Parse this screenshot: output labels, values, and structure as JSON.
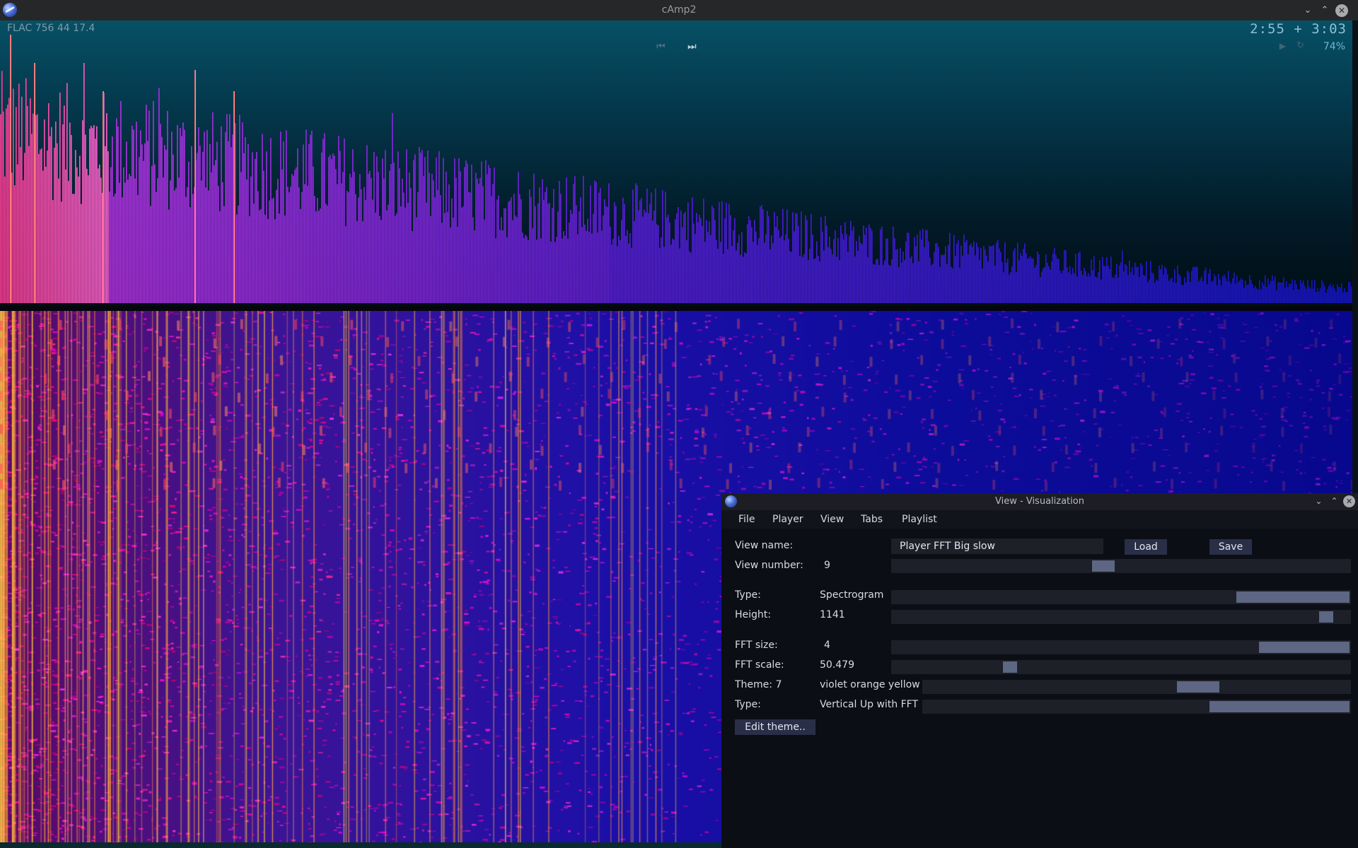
{
  "window": {
    "title": "cAmp2"
  },
  "player": {
    "format_info": "FLAC 756 44  17.4",
    "time_display": "2:55  +  3:03",
    "volume": "74%",
    "prev_glyph": "⏮",
    "next_glyph": "⏭",
    "play_glyph": "▶",
    "repeat_glyph": "↻"
  },
  "dialog": {
    "title": "View - Visualization",
    "menu": [
      "File",
      "Player",
      "View",
      "Tabs",
      "Playlist"
    ],
    "view_name_label": "View name:",
    "view_name_value": "Player FFT Big slow",
    "load_label": "Load",
    "save_label": "Save",
    "view_number_label": "View number:",
    "view_number_value": "9",
    "view_number_level": 0.46,
    "type_label": "Type:",
    "type_value": "Spectrogram",
    "type_level": 0.75,
    "height_label": "Height:",
    "height_value": "1141",
    "height_level": 0.96,
    "fft_size_label": "FFT size:",
    "fft_size_value": "4",
    "fft_size_level": 0.8,
    "fft_scale_label": "FFT scale:",
    "fft_scale_value": "50.479",
    "fft_scale_level": 0.25,
    "theme_label": "Theme:  7",
    "theme_value": "violet orange yellow",
    "theme_level": 0.66,
    "type2_label": "Type:",
    "type2_value": "Vertical Up with FFT",
    "type2_level": 0.67,
    "edit_theme_label": "Edit theme.."
  },
  "colors": {
    "accent": "#5d6682",
    "spectrum_low": "#ff3b8a",
    "spectrum_mid": "#8a30d8",
    "spectrum_high": "#1a20d0"
  }
}
